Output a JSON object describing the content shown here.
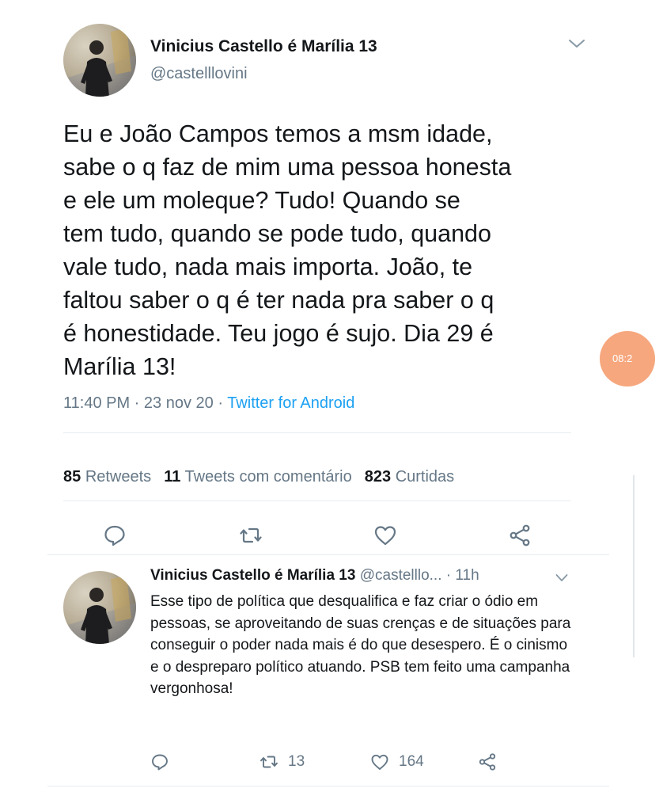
{
  "main_tweet": {
    "display_name": "Vinicius Castello é Marília 13",
    "handle": "@castelllovini",
    "text": "Eu e João Campos temos a msm idade,\nsabe o q faz de mim uma pessoa honesta\ne ele um moleque? Tudo! Quando se\ntem tudo, quando se pode tudo, quando\nvale tudo, nada mais importa. João, te\nfaltou saber o q é ter nada pra saber o q\né honestidade. Teu jogo é sujo. Dia 29 é\nMarília 13!",
    "time": "11:40 PM",
    "date": "23 nov 20",
    "source": "Twitter for Android",
    "separator": " · ",
    "stats": {
      "retweets_count": "85",
      "retweets_label": "Retweets",
      "comments_count": "11",
      "comments_label": "Tweets com comentário",
      "likes_count": "823",
      "likes_label": "Curtidas"
    },
    "actions": [
      "reply-icon",
      "retweet-icon",
      "like-icon",
      "share-icon"
    ]
  },
  "reply_tweet": {
    "display_name": "Vinicius Castello é Marília 13",
    "handle": "@castelllo...",
    "separator": " · ",
    "time_ago": "11h",
    "text": "Esse tipo de política que desqualifica e faz criar o ódio em pessoas, se aproveitando de suas crenças e de situações para conseguir o poder nada mais é do que desespero. É o cinismo e o despreparo político atuando. PSB tem feito uma campanha vergonhosa!",
    "retweets": "13",
    "likes": "164"
  },
  "overlay": {
    "bubble_text": "08:2"
  },
  "colors": {
    "text": "#14171a",
    "secondary": "#657786",
    "link": "#1da1f2",
    "divider": "#e6ecf0",
    "bubble": "#f6a77e"
  }
}
